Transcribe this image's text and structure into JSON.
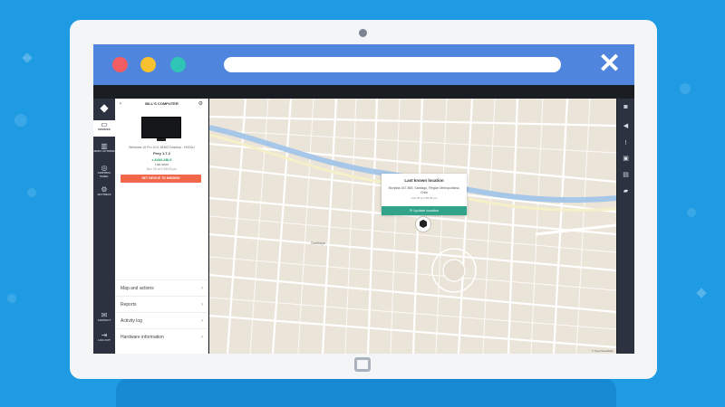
{
  "browser": {
    "close_icon": "close-x-icon",
    "traffic_lights": [
      "#f25d63",
      "#f7c22e",
      "#2ec4b6"
    ]
  },
  "nav": {
    "items": [
      {
        "label": "DEVICES",
        "icon": "laptop-icon"
      },
      {
        "label": "MANY ACTIONS",
        "icon": "chart-icon"
      },
      {
        "label": "CONTROL PANEL",
        "icon": "dial-icon"
      },
      {
        "label": "SETTINGS",
        "icon": "gear-icon"
      },
      {
        "label": "CONTACT",
        "icon": "chat-icon"
      },
      {
        "label": "LOG OUT",
        "icon": "logout-icon"
      }
    ]
  },
  "device": {
    "title": "BILL'S COMPUTER",
    "os": "Windows 10 Pro 10.0.18362 Desktop - HGDAJ",
    "version": "Prey 1.7.2",
    "status": "AVAILABLE",
    "last_seen": "Last seen",
    "last_seen_date": "Nov 05 at 2:55:05 pm",
    "missing_button": "SET DEVICE TO MISSING",
    "menu": [
      "Map and actions",
      "Reports",
      "Activity log",
      "Hardware information"
    ]
  },
  "map": {
    "popup_title": "Last known location",
    "popup_address": "Monjitas 437-565, Santiago, Región Metropolitana, Chile",
    "popup_time": "Nov 05 at 2:55:05 pm",
    "update_button": "Update location",
    "label_center": "Santiago",
    "credit": "© OpenStreetMap"
  },
  "rightbar": {
    "icons": [
      "camera-icon",
      "volume-icon",
      "alert-icon",
      "lock-icon",
      "trash-icon",
      "folder-icon"
    ]
  }
}
